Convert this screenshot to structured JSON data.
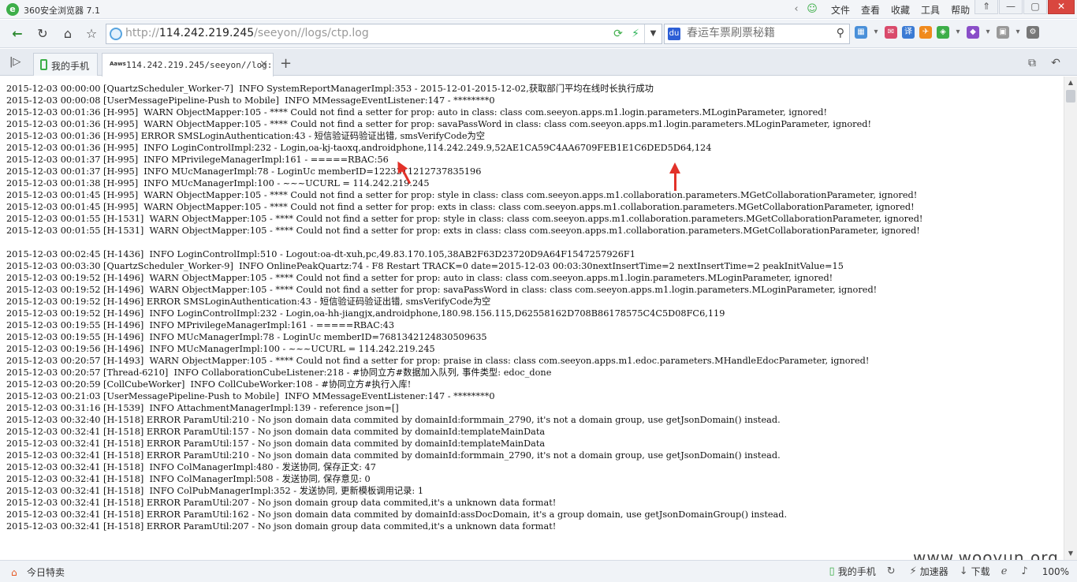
{
  "window": {
    "title": "360安全浏览器 7.1",
    "menu": [
      "文件",
      "查看",
      "收藏",
      "工具",
      "帮助"
    ],
    "controls": [
      "⇑",
      "—",
      "▢",
      "✕"
    ]
  },
  "nav": {
    "url_scheme": "http://",
    "url_host": "114.242.219.245",
    "url_path": "/seeyon//logs/ctp.log",
    "search_placeholder": "春运车票刷票秘籍"
  },
  "tabs": [
    {
      "label": "我的手机"
    },
    {
      "label": "114.242.219.245/seeyon//log:",
      "favicon": "Aaws"
    }
  ],
  "log_lines": [
    "2015-12-03 00:00:00 [QuartzScheduler_Worker-7]  INFO SystemReportManagerImpl:353 - 2015-12-01-2015-12-02,获取部门平均在线时长执行成功",
    "2015-12-03 00:00:08 [UserMessagePipeline-Push to Mobile]  INFO MMessageEventListener:147 - ********0",
    "2015-12-03 00:01:36 [H-995]  WARN ObjectMapper:105 - **** Could not find a setter for prop: auto in class: class com.seeyon.apps.m1.login.parameters.MLoginParameter, ignored!",
    "2015-12-03 00:01:36 [H-995]  WARN ObjectMapper:105 - **** Could not find a setter for prop: savaPassWord in class: class com.seeyon.apps.m1.login.parameters.MLoginParameter, ignored!",
    "2015-12-03 00:01:36 [H-995] ERROR SMSLoginAuthentication:43 - 短信验证码验证出错, smsVerifyCode为空",
    "2015-12-03 00:01:36 [H-995]  INFO LoginControlImpl:232 - Login,oa-kj-taoxq,androidphone,114.242.249.9,52AE1CA59C4AA6709FEB1E1C6DED5D64,124",
    "2015-12-03 00:01:37 [H-995]  INFO MPrivilegeManagerImpl:161 - =====RBAC:56",
    "2015-12-03 00:01:37 [H-995]  INFO MUcManagerImpl:78 - LoginUc memberID=1223311212737835196",
    "2015-12-03 00:01:38 [H-995]  INFO MUcManagerImpl:100 - ~~~UCURL = 114.242.219.245",
    "2015-12-03 00:01:45 [H-995]  WARN ObjectMapper:105 - **** Could not find a setter for prop: style in class: class com.seeyon.apps.m1.collaboration.parameters.MGetCollaborationParameter, ignored!",
    "2015-12-03 00:01:45 [H-995]  WARN ObjectMapper:105 - **** Could not find a setter for prop: exts in class: class com.seeyon.apps.m1.collaboration.parameters.MGetCollaborationParameter, ignored!",
    "2015-12-03 00:01:55 [H-1531]  WARN ObjectMapper:105 - **** Could not find a setter for prop: style in class: class com.seeyon.apps.m1.collaboration.parameters.MGetCollaborationParameter, ignored!",
    "2015-12-03 00:01:55 [H-1531]  WARN ObjectMapper:105 - **** Could not find a setter for prop: exts in class: class com.seeyon.apps.m1.collaboration.parameters.MGetCollaborationParameter, ignored!",
    "",
    "2015-12-03 00:02:45 [H-1436]  INFO LoginControlImpl:510 - Logout:oa-dt-xuh,pc,49.83.170.105,38AB2F63D23720D9A64F1547257926F1",
    "2015-12-03 00:03:30 [QuartzScheduler_Worker-9]  INFO OnlinePeakQuartz:74 - F8 Restart TRACK=0 date=2015-12-03 00:03:30nextInsertTime=2 nextInsertTime=2 peakInitValue=15",
    "2015-12-03 00:19:52 [H-1496]  WARN ObjectMapper:105 - **** Could not find a setter for prop: auto in class: class com.seeyon.apps.m1.login.parameters.MLoginParameter, ignored!",
    "2015-12-03 00:19:52 [H-1496]  WARN ObjectMapper:105 - **** Could not find a setter for prop: savaPassWord in class: class com.seeyon.apps.m1.login.parameters.MLoginParameter, ignored!",
    "2015-12-03 00:19:52 [H-1496] ERROR SMSLoginAuthentication:43 - 短信验证码验证出错, smsVerifyCode为空",
    "2015-12-03 00:19:52 [H-1496]  INFO LoginControlImpl:232 - Login,oa-hh-jiangjx,androidphone,180.98.156.115,D62558162D708B86178575C4C5D08FC6,119",
    "2015-12-03 00:19:55 [H-1496]  INFO MPrivilegeManagerImpl:161 - =====RBAC:43",
    "2015-12-03 00:19:55 [H-1496]  INFO MUcManagerImpl:78 - LoginUc memberID=7681342124830509635",
    "2015-12-03 00:19:56 [H-1496]  INFO MUcManagerImpl:100 - ~~~UCURL = 114.242.219.245",
    "2015-12-03 00:20:57 [H-1493]  WARN ObjectMapper:105 - **** Could not find a setter for prop: praise in class: class com.seeyon.apps.m1.edoc.parameters.MHandleEdocParameter, ignored!",
    "2015-12-03 00:20:57 [Thread-6210]  INFO CollaborationCubeListener:218 - #协同立方#数据加入队列, 事件类型: edoc_done",
    "2015-12-03 00:20:59 [CollCubeWorker]  INFO CollCubeWorker:108 - #协同立方#执行入库!",
    "2015-12-03 00:21:03 [UserMessagePipeline-Push to Mobile]  INFO MMessageEventListener:147 - ********0",
    "2015-12-03 00:31:16 [H-1539]  INFO AttachmentManagerImpl:139 - reference json=[]",
    "2015-12-03 00:32:40 [H-1518] ERROR ParamUtil:210 - No json domain data commited by domainId:formmain_2790, it's not a domain group, use getJsonDomain() instead.",
    "2015-12-03 00:32:41 [H-1518] ERROR ParamUtil:157 - No json domain data commited by domainId:templateMainData",
    "2015-12-03 00:32:41 [H-1518] ERROR ParamUtil:157 - No json domain data commited by domainId:templateMainData",
    "2015-12-03 00:32:41 [H-1518] ERROR ParamUtil:210 - No json domain data commited by domainId:formmain_2790, it's not a domain group, use getJsonDomain() instead.",
    "2015-12-03 00:32:41 [H-1518]  INFO ColManagerImpl:480 - 发送协同, 保存正文: 47",
    "2015-12-03 00:32:41 [H-1518]  INFO ColManagerImpl:508 - 发送协同, 保存意见: 0",
    "2015-12-03 00:32:41 [H-1518]  INFO ColPubManagerImpl:352 - 发送协同, 更新模板调用记录: 1",
    "2015-12-03 00:32:41 [H-1518] ERROR ParamUtil:207 - No json domain group data commited,it's a unknown data format!",
    "2015-12-03 00:32:41 [H-1518] ERROR ParamUtil:162 - No json domain data commited by domainId:assDocDomain, it's a group domain, use getJsonDomainGroup() instead.",
    "2015-12-03 00:32:41 [H-1518] ERROR ParamUtil:207 - No json domain group data commited,it's a unknown data format!"
  ],
  "watermark": "www.wooyun.org",
  "status": {
    "left_label": "今日特卖",
    "right_items": [
      "我的手机",
      "加速器",
      "下载"
    ],
    "zoom": "100%"
  }
}
